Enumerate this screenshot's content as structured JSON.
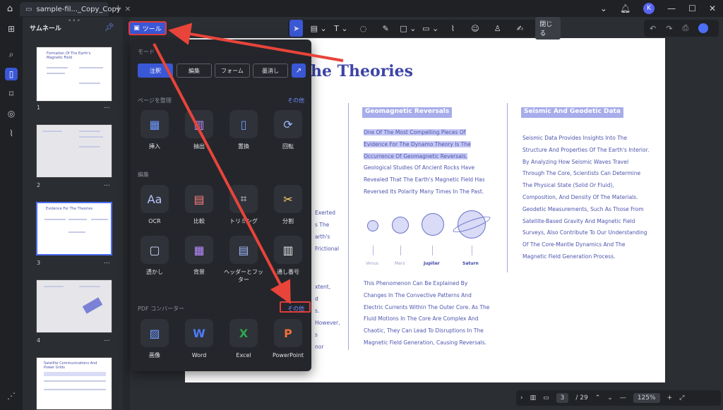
{
  "titlebar": {
    "tab_title": "sample-fil..._Copy_Copy",
    "avatar_letter": "K"
  },
  "thumbnails": {
    "header": "サムネール",
    "pages": [
      {
        "num": "1",
        "title": "Formation Of The Earth's Magnetic Field"
      },
      {
        "num": "2",
        "title": ""
      },
      {
        "num": "3",
        "title": "Evidence For The Theories"
      },
      {
        "num": "4",
        "title": ""
      },
      {
        "num": "",
        "title": "Satellite Communications And Power Grids"
      }
    ],
    "more": "..."
  },
  "toolbar": {
    "close_label": "閉じる"
  },
  "tools_button": {
    "label": "ツール"
  },
  "tools_panel": {
    "mode_label": "モード",
    "modes": [
      "注釈",
      "編集",
      "フォーム",
      "墨消し"
    ],
    "organize_label": "ページを整理",
    "organize_more": "その他",
    "organize_tools": [
      "挿入",
      "抽出",
      "置換",
      "回転"
    ],
    "edit_label": "編集",
    "edit_tools": [
      "OCR",
      "比較",
      "トリミング",
      "分割",
      "透かし",
      "背景",
      "ヘッダーとフッター",
      "通し番号"
    ],
    "converter_label": "PDF コンバーター",
    "converter_more": "その他",
    "converter_tools": [
      "画像",
      "Word",
      "Excel",
      "PowerPoint"
    ]
  },
  "document": {
    "heading": "he Theories",
    "col2": {
      "title": "Geomagnetic Reversals",
      "highlighted": "One Of The Most Compelling Pieces Of Evidence For The Dynamo Theory Is The Occurrence Of Geomagnetic Reversals.",
      "text": "Geological Studies Of Ancient Rocks Have Revealed That The Earth's Magnetic Field Has Reversed Its Polarity Many Times In The Past.",
      "planets": [
        "Venus",
        "Mars",
        "Jupiter",
        "Saturn"
      ],
      "text2": "This Phenomenon Can Be Explained By Changes In The Convective Patterns And Electric Currents Within The Outer Core. As The Fluid Motions In The Core Are Complex And Chaotic, They Can Lead To Disruptions In The Magnetic Field Generation, Causing Reversals."
    },
    "col3": {
      "title": "Seismic And Geodetic Data",
      "text": "Seismic Data Provides Insights Into The Structure And Properties Of The Earth's Interior. By Analyzing How Seismic Waves Travel Through The Core, Scientists Can Determine The Physical State (Solid Or Fluid), Composition, And Density Of The Materials. Geodetic Measurements, Such As Those From Satellite-Based Gravity And Magnetic Field Surveys, Also Contribute To Our Understanding Of The Core-Mantle Dynamics And The Magnetic Field Generation Process."
    },
    "fragments": [
      "Exerted",
      "s The",
      "arth's",
      "Frictional",
      "xtent,",
      "d",
      "s.",
      "However,",
      "s",
      "nor"
    ]
  },
  "zoombar": {
    "page": "3",
    "total": "/ 29",
    "zoom": "125%"
  },
  "colors": {
    "accent": "#3a57d6",
    "annotation_red": "#e23c3c",
    "heading": "#3d44a8"
  }
}
